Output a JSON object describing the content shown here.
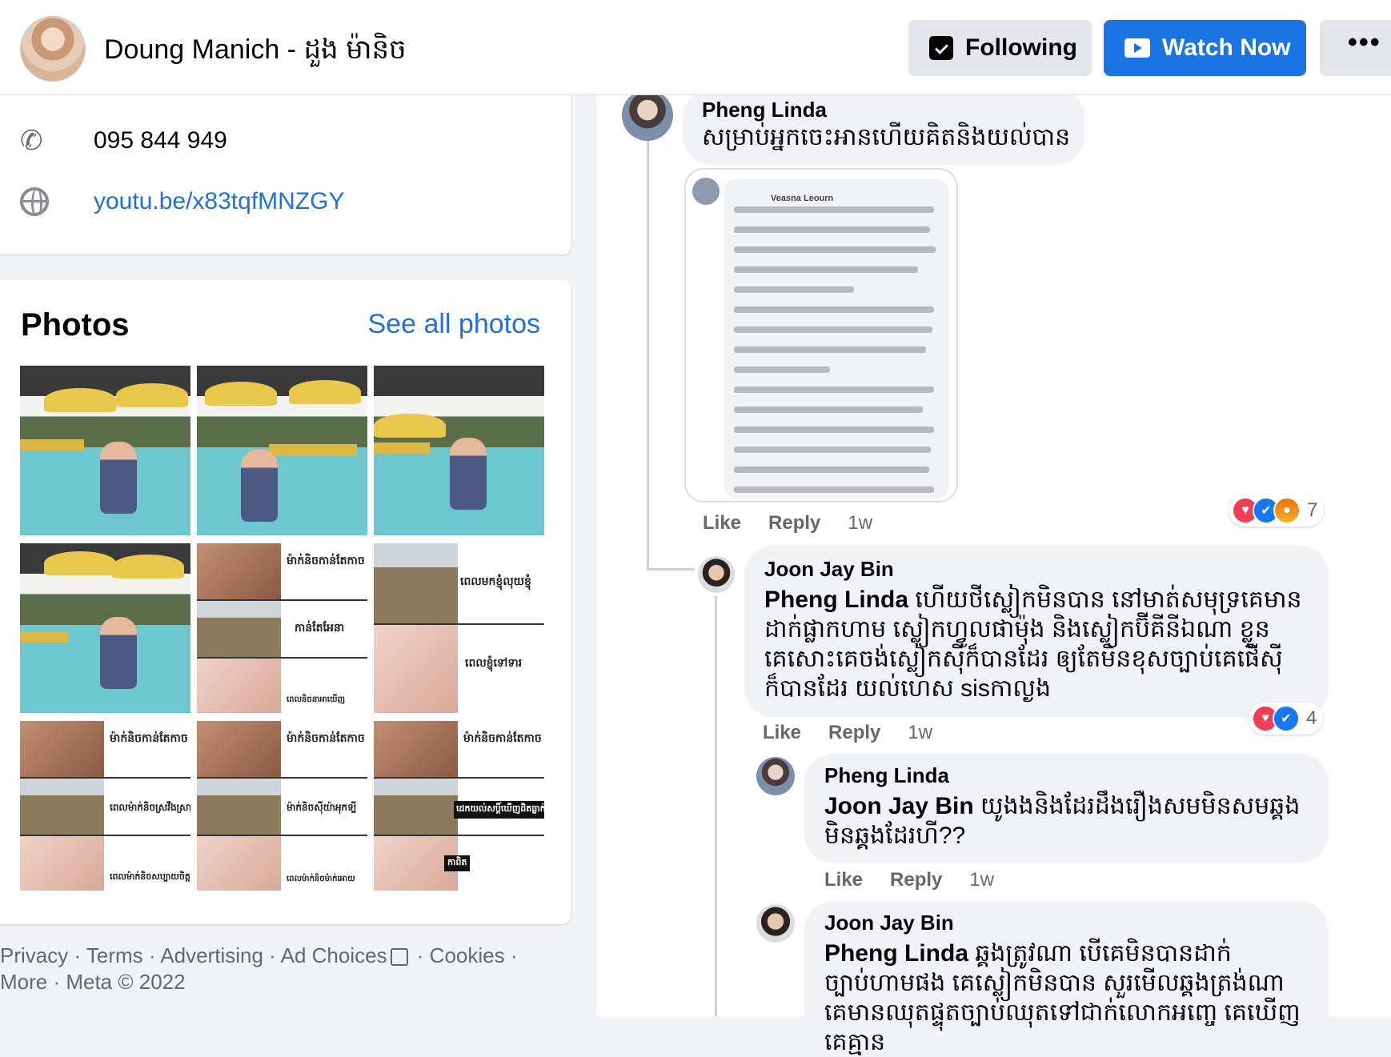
{
  "header": {
    "page_name": "Doung Manich - ដួង ម៉ានិច",
    "following_label": "Following",
    "watch_label": "Watch Now",
    "more_label": "•••"
  },
  "intro": {
    "phone": "095 844 949",
    "website": "youtu.be/x83tqfMNZGY"
  },
  "photos": {
    "title": "Photos",
    "see_all": "See all photos",
    "memes": {
      "m1": [
        "ម៉ាក់និចកាន់តែកាច",
        "កាន់តែអែនា",
        "ពេលនិចនាអាយើញ"
      ],
      "m2": [
        "ពេលមកខ្ញុំលុយខ្ញុំ",
        "ពេលខ្ញុំទៅទារ"
      ],
      "m3": [
        "ម៉ាក់និចកាន់តែកាច",
        "ពេលម៉ាក់និចស្រវឹងស្រា",
        "ពេលម៉ាក់និចសប្បាយចិត្ត"
      ],
      "m4": [
        "ម៉ាក់និចកាន់តែកាច",
        "ម៉ាក់និចស៊ីយ៉ាអុកទ្បី",
        "ពេលម៉ាក់និចម៉ាក់អោយ"
      ],
      "m5": [
        "ម៉ាក់និចកាន់តែកាច",
        "ដេកយល់សប្តិ៍ឃើញដិតធ្លាក់គំលើខ្ញុំ",
        "កាពិត"
      ]
    }
  },
  "footer": {
    "line1": "Privacy · Terms · Advertising · Ad Choices",
    "line1_end": " · Cookies ·",
    "line2": "More · Meta © 2022"
  },
  "comments": {
    "c1": {
      "author": "Pheng Linda",
      "text": "សម្រាប់អ្នកចេះអានហើយគិតនិងយល់បាន",
      "image_author": "Veasna Leourn",
      "like": "Like",
      "reply": "Reply",
      "time": "1w",
      "reactions": "7"
    },
    "c2": {
      "author": "Joon Jay Bin",
      "mention": "Pheng Linda",
      "text": " ហើយថីស្លៀកមិនបាន នៅមាត់សមុទ្រគេមានដាក់ផ្លាកហាម ស្លៀកហ្វូលផាម៉ុង និងស្លៀកប៊ីគីនីឯណា ខ្លួនគេសោះគេចង់ស្លៀកស៊ីក៏បានដែរ ឲ្យតែមិនខុសច្បាប់គេផើស៊ីក៏បានដែរ យល់ហេស sisកាល្ងង",
      "like": "Like",
      "reply": "Reply",
      "time": "1w",
      "reactions": "4"
    },
    "c3": {
      "author": "Pheng Linda",
      "mention": "Joon Jay Bin",
      "text": " យូងងនិងដែរដឹងរឿងសមមិនសមឆ្គងមិនឆ្គងដែរហី??",
      "like": "Like",
      "reply": "Reply",
      "time": "1w"
    },
    "c4": {
      "author": "Joon Jay Bin",
      "mention": "Pheng Linda",
      "text": " ឆ្គងត្រូវណា បើគេមិនបានដាក់ច្បាប់ហាមផង គេស្លៀកមិនបាន សួរមើលឆ្គងត្រង់ណា គេមានឈុតផ្ទុតច្បាប់ឈុតទៅជាក់លោកអញ្ចេ គេឃើញគេគ្មាន"
    }
  },
  "colors": {
    "accent": "#1b74e4",
    "link": "#216fdb",
    "muted": "#65676b",
    "bubble": "#f0f2f5"
  },
  "icons": [
    "phone-icon",
    "globe-icon",
    "following-icon",
    "watch-icon",
    "ad-choices-icon",
    "love-reaction-icon",
    "like-reaction-icon",
    "angry-reaction-icon"
  ]
}
